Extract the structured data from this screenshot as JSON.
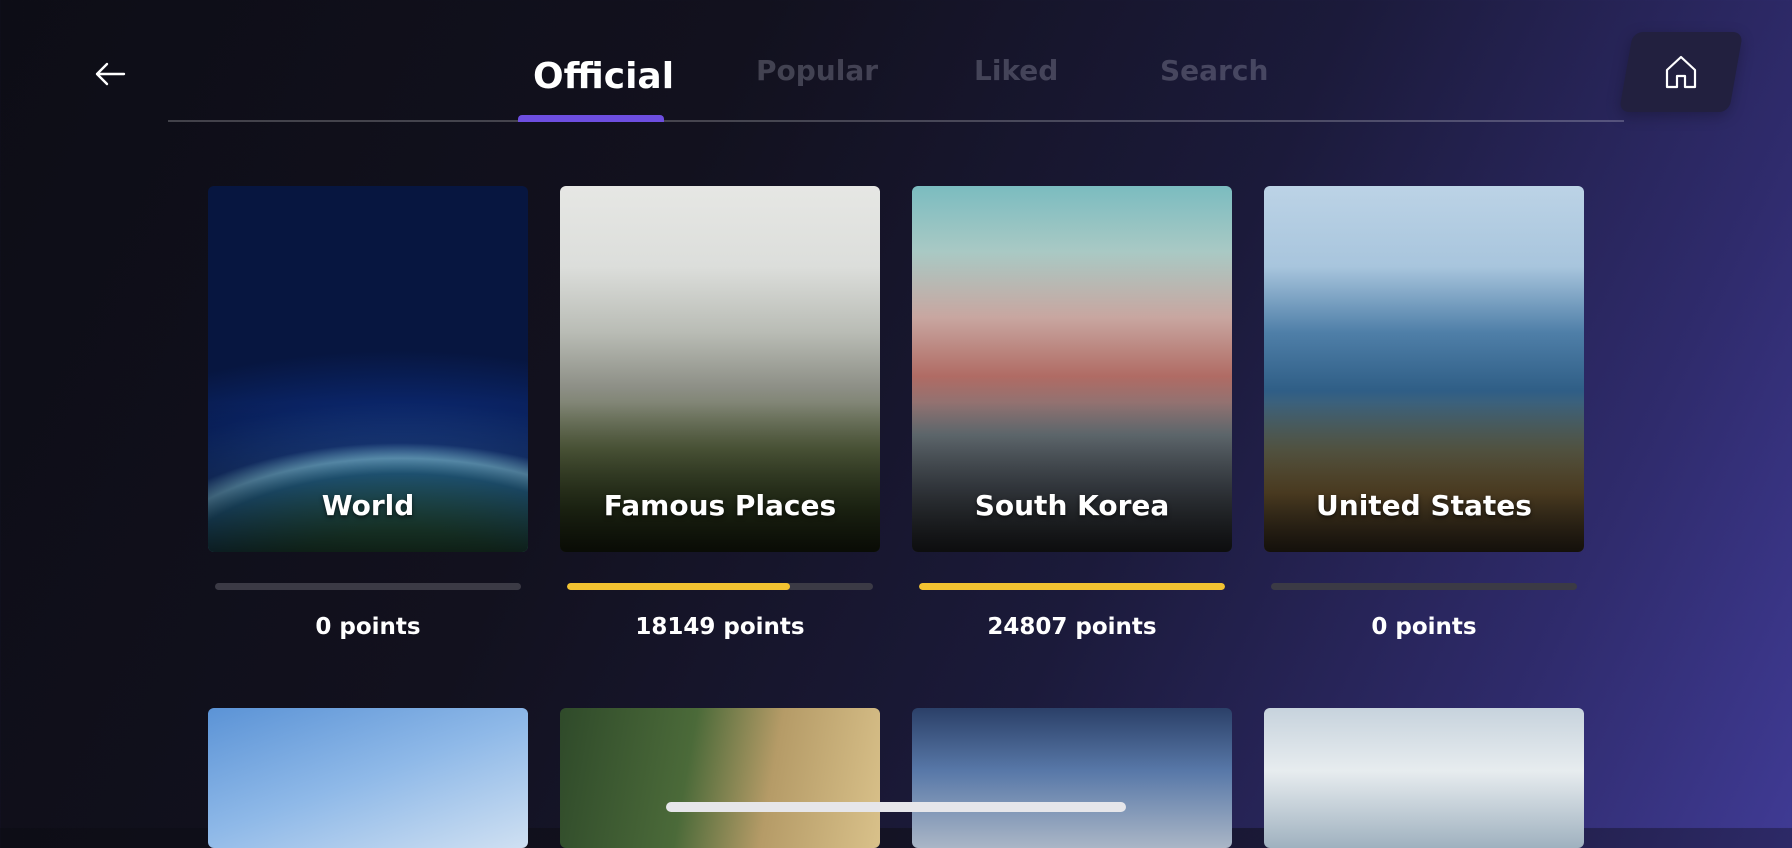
{
  "tabs": [
    {
      "label": "Official"
    },
    {
      "label": "Popular"
    },
    {
      "label": "Liked"
    },
    {
      "label": "Search"
    }
  ],
  "icons": {
    "back": "arrow-left-icon",
    "home": "home-icon"
  },
  "colors": {
    "accent": "#6d4ee0",
    "progress_fill": "#f2c231",
    "progress_track": "#3b3a45"
  },
  "cards": [
    {
      "title": "World",
      "points_text": "0 points",
      "progress": 0
    },
    {
      "title": "Famous Places",
      "points_text": "18149 points",
      "progress": 0.73
    },
    {
      "title": "South Korea",
      "points_text": "24807 points",
      "progress": 1.0
    },
    {
      "title": "United States",
      "points_text": "0 points",
      "progress": 0
    }
  ]
}
